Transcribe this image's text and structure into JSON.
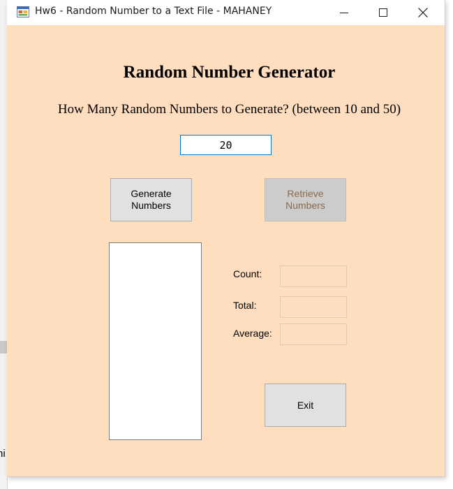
{
  "window": {
    "title": "Hw6 - Random Number to a Text File - MAHANEY",
    "icon": "winforms-app-icon",
    "controls": [
      "minimize-icon",
      "maximize-icon",
      "close-icon"
    ]
  },
  "form": {
    "heading": "Random Number Generator",
    "prompt": "How Many Random Numbers to Generate? (between 10 and 50)",
    "count_input_value": "20",
    "generate_label": "Generate\nNumbers",
    "retrieve_label": "Retrieve\nNumbers",
    "retrieve_enabled": false,
    "exit_label": "Exit",
    "exit_mnemonic": "x",
    "numbers_list": [],
    "count_label": "Count:",
    "total_label": "Total:",
    "average_label": "Average:",
    "count_value": "",
    "total_value": "",
    "average_value": ""
  },
  "desktop": {
    "clipped_text": "hi"
  },
  "colors": {
    "form_background": "#ffdec0",
    "button_face": "#e1e1e1",
    "disabled_button": "#cccccc",
    "disabled_text": "#8b6a4a",
    "focus_border": "#0078d7"
  }
}
